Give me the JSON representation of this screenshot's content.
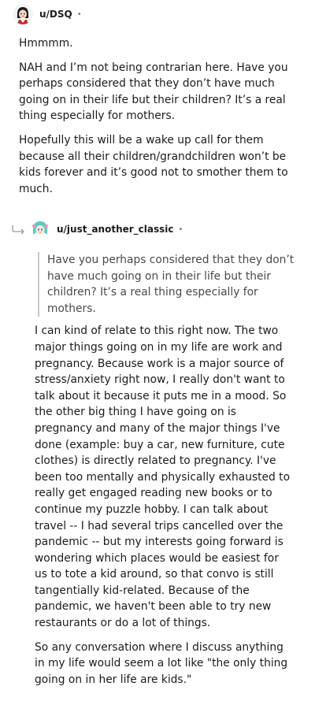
{
  "comment1": {
    "username": "u/DSQ",
    "separator": "•",
    "paragraphs": [
      "Hmmmm.",
      "NAH and I’m not being contrarian here. Have you perhaps considered that they don’t have much going on in their life but their children? It’s a real thing especially for mothers.",
      "Hopefully this will be a wake up call for them because all their children/grandchildren won’t be kids forever and it’s good not to smother them to much."
    ]
  },
  "comment2": {
    "username": "u/just_another_classic",
    "separator": "•",
    "quote": "Have you perhaps considered that they don’t have much going on in their life but their children? It’s a real thing especially for mothers.",
    "paragraphs": [
      "I can kind of relate to this right now. The two major things going on in my life are work and pregnancy. Because work is a major source of stress/anxiety right now, I really don't want to talk about it because it puts me in a mood. So the other big thing I have going on is pregnancy and many of the major things I've done (example: buy a car, new furniture, cute clothes) is directly related to pregnancy. I've been too mentally and physically exhausted to really get engaged reading new books or to continue my puzzle hobby. I can talk about travel -- I had several trips cancelled over the pandemic -- but my interests going forward is wondering which places would be easiest for us to tote a kid around, so that convo is still tangentially kid-related. Because of the pandemic, we haven't been able to try new restaurants or do a lot of things.",
      "So any conversation where I discuss anything in my life would seem a lot like \"the only thing going on in her life are kids.\""
    ]
  }
}
